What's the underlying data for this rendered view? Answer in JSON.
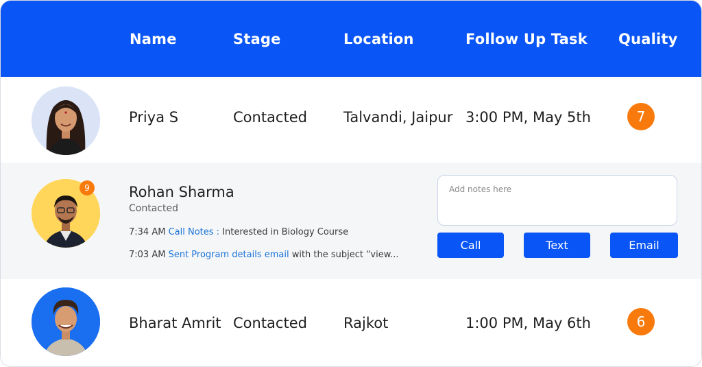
{
  "header": {
    "columns": [
      "Name",
      "Stage",
      "Location",
      "Follow Up Task",
      "Quality"
    ]
  },
  "rows": [
    {
      "name": "Priya S",
      "stage": "Contacted",
      "location": "Talvandi, Jaipur",
      "follow_up": "3:00 PM, May 5th",
      "quality": "7",
      "avatar_bg": "#dbe4f7"
    },
    {
      "name": "Bharat Amrit",
      "stage": "Contacted",
      "location": "Rajkot",
      "follow_up": "1:00 PM, May 6th",
      "quality": "6",
      "avatar_bg": "#1a6ff0"
    }
  ],
  "expanded": {
    "name": "Rohan Sharma",
    "stage": "Contacted",
    "badge": "9",
    "avatar_bg": "#ffd65a",
    "activities": [
      {
        "time": "7:34 AM",
        "link": "Call Notes :",
        "text": " Interested in Biology Course"
      },
      {
        "time": "7:03 AM",
        "link": "Sent Program details email",
        "text": " with the subject “view..."
      }
    ],
    "notes_placeholder": "Add notes here",
    "buttons": {
      "call": "Call",
      "text": "Text",
      "email": "Email"
    }
  },
  "colors": {
    "header_bg": "#0a55f5",
    "accent_orange": "#f97a0c",
    "link": "#1a73d9",
    "expanded_row_bg": "#f5f6f7"
  },
  "icons": [
    "avatar-priya",
    "avatar-rohan",
    "avatar-bharat"
  ]
}
